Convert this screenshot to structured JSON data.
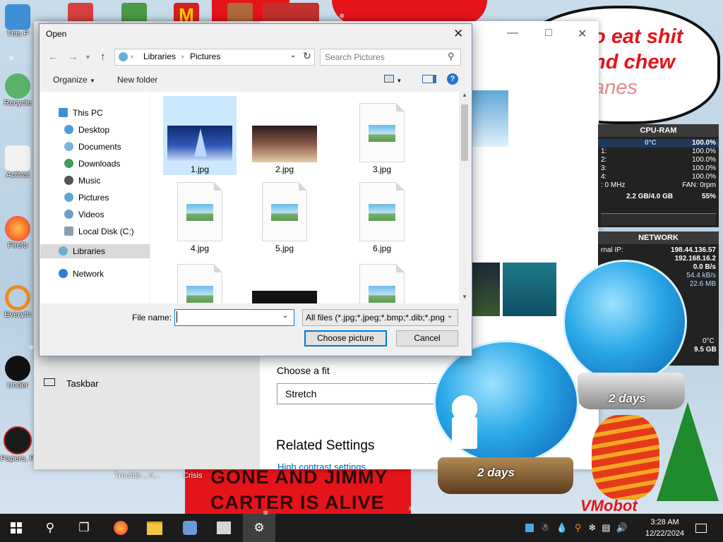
{
  "desktop": {
    "icons": [
      {
        "label": "This P"
      },
      {
        "label": "Recycle"
      },
      {
        "label": "Activat"
      },
      {
        "label": "Firefo"
      },
      {
        "label": "Everyth"
      },
      {
        "label": "Under"
      },
      {
        "label": "Papers, P"
      }
    ],
    "bubble_lines": [
      "o eat shit",
      "nd chew",
      "anes"
    ],
    "banner_lines": [
      "GONE AND JIMMY",
      "CARTER IS ALIVE"
    ],
    "bottom_labels": [
      "Trouble... A...",
      "Crisis"
    ],
    "corner_text": "VMobot"
  },
  "settings_window": {
    "taskbar_item": "Taskbar",
    "choose_fit_label": "Choose a fit",
    "fit_value": "Stretch",
    "related_settings": "Related Settings",
    "high_contrast_link": "High contrast settings"
  },
  "widgets": {
    "cpu": {
      "title": "CPU-RAM",
      "temp": "0°C",
      "total": "100.0%",
      "cores": [
        {
          "n": "1:",
          "v": "100.0%"
        },
        {
          "n": "2:",
          "v": "100.0%"
        },
        {
          "n": "3:",
          "v": "100.0%"
        },
        {
          "n": "4:",
          "v": "100.0%"
        }
      ],
      "freq": ": 0 MHz",
      "fan": "FAN: 0rpm",
      "ram": "2.2 GB/4.0 GB",
      "ram_pct": "55%"
    },
    "network": {
      "title": "NETWORK",
      "ext_label": "rnal IP:",
      "ext_ip": "198.44.136.57",
      "int_ip": "192.168.16.2",
      "up": "0.0 B/s",
      "down": "54.4 kB/s",
      "total": "22.6 MB"
    },
    "globe_label": "2 days",
    "lower_temp": "0°C",
    "lower_size": "9.5 GB"
  },
  "dialog": {
    "title": "Open",
    "breadcrumb": [
      "Libraries",
      "Pictures"
    ],
    "search_placeholder": "Search Pictures",
    "organize": "Organize",
    "new_folder": "New folder",
    "nav": [
      {
        "label": "This PC",
        "color": "#3d8fd6"
      },
      {
        "label": "Desktop",
        "color": "#4a9fd8"
      },
      {
        "label": "Documents",
        "color": "#7ab6d8"
      },
      {
        "label": "Downloads",
        "color": "#3f9c5c"
      },
      {
        "label": "Music",
        "color": "#555555"
      },
      {
        "label": "Pictures",
        "color": "#5aa9d8"
      },
      {
        "label": "Videos",
        "color": "#6ba0c8"
      },
      {
        "label": "Local Disk (C:)",
        "color": "#8aa0b0"
      },
      {
        "label": "Libraries",
        "color": "#6aaed6"
      },
      {
        "label": "Network",
        "color": "#2d7fd0"
      }
    ],
    "files": [
      {
        "name": "1.jpg"
      },
      {
        "name": "2.jpg"
      },
      {
        "name": "3.jpg"
      },
      {
        "name": "4.jpg"
      },
      {
        "name": "5.jpg"
      },
      {
        "name": "6.jpg"
      }
    ],
    "file_name_label": "File name:",
    "file_name_value": "",
    "file_type": "All files (*.jpg;*.jpeg;*.bmp;*.dib;*.png",
    "choose_button": "Choose picture",
    "cancel_button": "Cancel"
  },
  "taskbar": {
    "time": "3:28 AM",
    "date": "12/22/2024"
  }
}
